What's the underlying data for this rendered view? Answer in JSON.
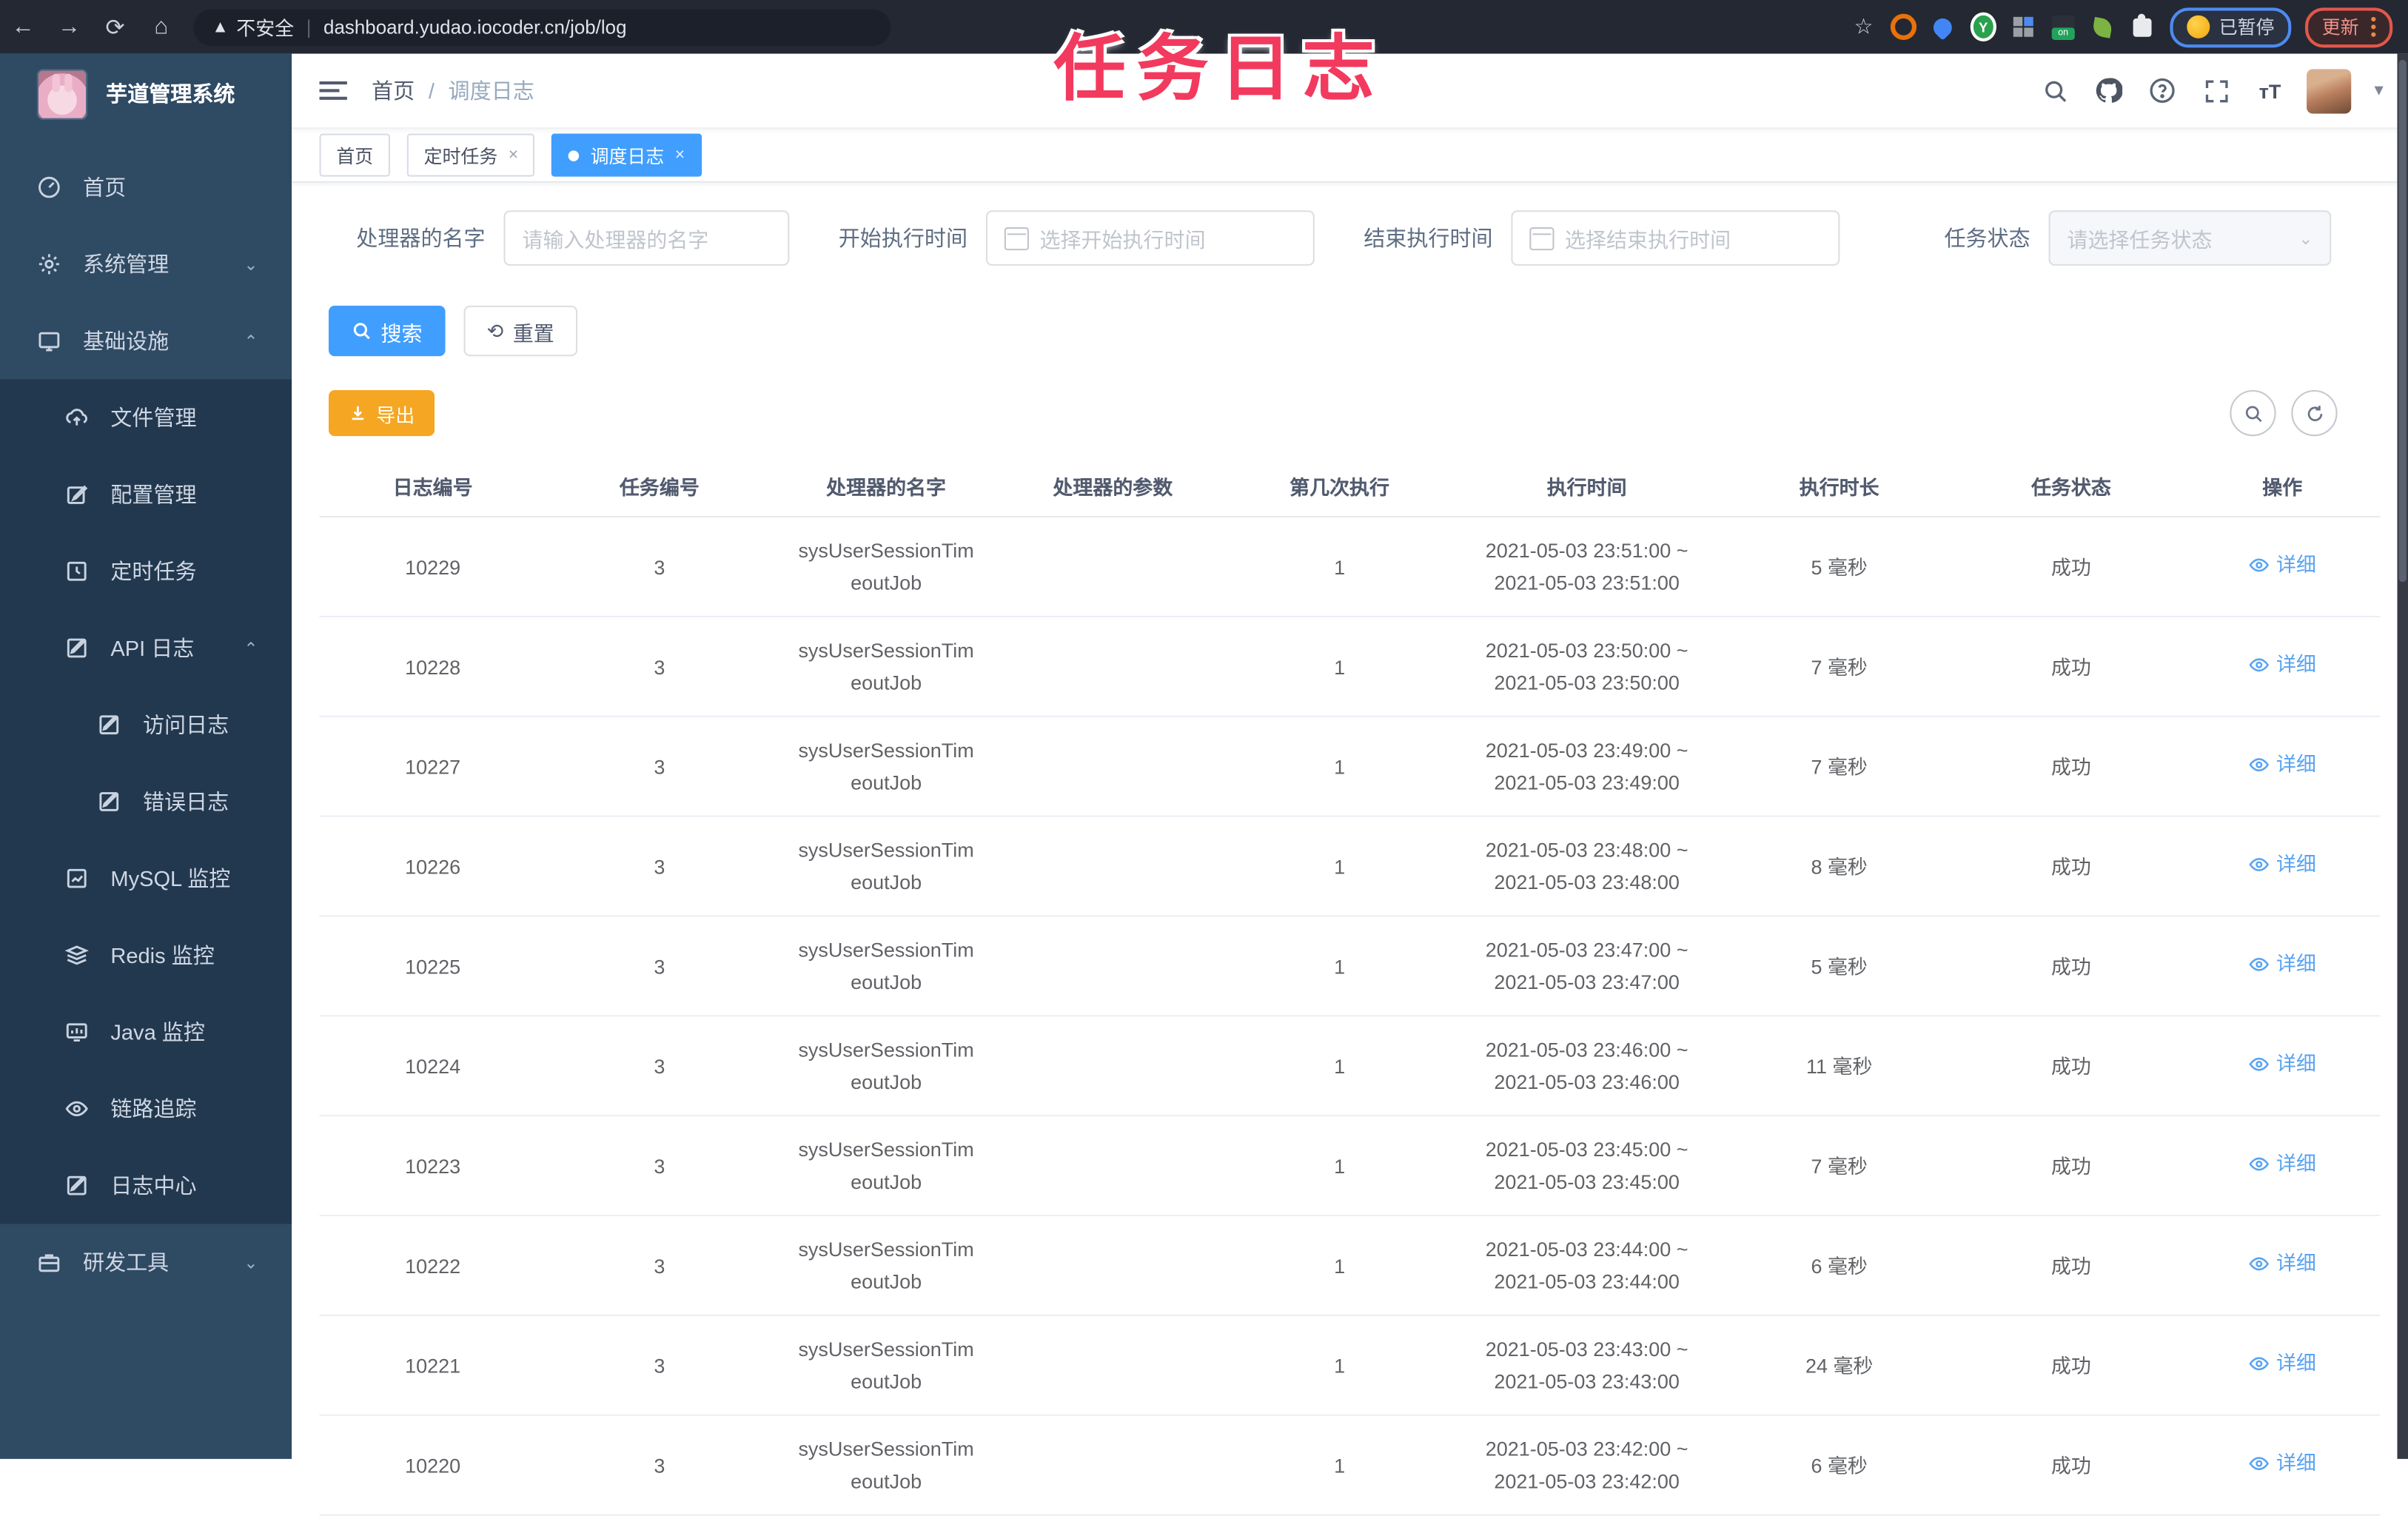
{
  "browser": {
    "security_label": "不安全",
    "url": "dashboard.yudao.iocoder.cn/job/log",
    "paused_badge": "已暂停",
    "update_button": "更新"
  },
  "overlay_title": "任务日志",
  "sidebar": {
    "app_title": "芋道管理系统",
    "items": [
      {
        "label": "首页"
      },
      {
        "label": "系统管理"
      },
      {
        "label": "基础设施"
      },
      {
        "label": "文件管理"
      },
      {
        "label": "配置管理"
      },
      {
        "label": "定时任务"
      },
      {
        "label": "API 日志"
      },
      {
        "label": "访问日志"
      },
      {
        "label": "错误日志"
      },
      {
        "label": "MySQL 监控"
      },
      {
        "label": "Redis 监控"
      },
      {
        "label": "Java 监控"
      },
      {
        "label": "链路追踪"
      },
      {
        "label": "日志中心"
      },
      {
        "label": "研发工具"
      }
    ]
  },
  "breadcrumb": {
    "home": "首页",
    "sep": "/",
    "current": "调度日志"
  },
  "tabs": [
    {
      "label": "首页"
    },
    {
      "label": "定时任务",
      "close": "×"
    },
    {
      "label": "调度日志",
      "close": "×"
    }
  ],
  "filters": {
    "handler_label": "处理器的名字",
    "handler_placeholder": "请输入处理器的名字",
    "start_label": "开始执行时间",
    "start_placeholder": "选择开始执行时间",
    "end_label": "结束执行时间",
    "end_placeholder": "选择结束执行时间",
    "status_label": "任务状态",
    "status_placeholder": "请选择任务状态"
  },
  "actions": {
    "search": "搜索",
    "reset": "重置",
    "export": "导出"
  },
  "colors": {
    "accent": "#409eff",
    "warning": "#f5a623",
    "link": "#57a3f3",
    "overlay": "#f23a5e",
    "sidebar_bg": "#2f4a63",
    "submenu_bg": "#22384e"
  },
  "table": {
    "columns": [
      "日志编号",
      "任务编号",
      "处理器的名字",
      "处理器的参数",
      "第几次执行",
      "执行时间",
      "执行时长",
      "任务状态",
      "操作"
    ],
    "rows": [
      {
        "id": "10229",
        "job": "3",
        "handler1": "sysUserSessionTim",
        "handler2": "eoutJob",
        "param": "",
        "idx": "1",
        "time1": "2021-05-03 23:51:00 ~",
        "time2": "2021-05-03 23:51:00",
        "dur": "5 毫秒",
        "status": "成功",
        "op": "详细"
      },
      {
        "id": "10228",
        "job": "3",
        "handler1": "sysUserSessionTim",
        "handler2": "eoutJob",
        "param": "",
        "idx": "1",
        "time1": "2021-05-03 23:50:00 ~",
        "time2": "2021-05-03 23:50:00",
        "dur": "7 毫秒",
        "status": "成功",
        "op": "详细"
      },
      {
        "id": "10227",
        "job": "3",
        "handler1": "sysUserSessionTim",
        "handler2": "eoutJob",
        "param": "",
        "idx": "1",
        "time1": "2021-05-03 23:49:00 ~",
        "time2": "2021-05-03 23:49:00",
        "dur": "7 毫秒",
        "status": "成功",
        "op": "详细"
      },
      {
        "id": "10226",
        "job": "3",
        "handler1": "sysUserSessionTim",
        "handler2": "eoutJob",
        "param": "",
        "idx": "1",
        "time1": "2021-05-03 23:48:00 ~",
        "time2": "2021-05-03 23:48:00",
        "dur": "8 毫秒",
        "status": "成功",
        "op": "详细"
      },
      {
        "id": "10225",
        "job": "3",
        "handler1": "sysUserSessionTim",
        "handler2": "eoutJob",
        "param": "",
        "idx": "1",
        "time1": "2021-05-03 23:47:00 ~",
        "time2": "2021-05-03 23:47:00",
        "dur": "5 毫秒",
        "status": "成功",
        "op": "详细"
      },
      {
        "id": "10224",
        "job": "3",
        "handler1": "sysUserSessionTim",
        "handler2": "eoutJob",
        "param": "",
        "idx": "1",
        "time1": "2021-05-03 23:46:00 ~",
        "time2": "2021-05-03 23:46:00",
        "dur": "11 毫秒",
        "status": "成功",
        "op": "详细"
      },
      {
        "id": "10223",
        "job": "3",
        "handler1": "sysUserSessionTim",
        "handler2": "eoutJob",
        "param": "",
        "idx": "1",
        "time1": "2021-05-03 23:45:00 ~",
        "time2": "2021-05-03 23:45:00",
        "dur": "7 毫秒",
        "status": "成功",
        "op": "详细"
      },
      {
        "id": "10222",
        "job": "3",
        "handler1": "sysUserSessionTim",
        "handler2": "eoutJob",
        "param": "",
        "idx": "1",
        "time1": "2021-05-03 23:44:00 ~",
        "time2": "2021-05-03 23:44:00",
        "dur": "6 毫秒",
        "status": "成功",
        "op": "详细"
      },
      {
        "id": "10221",
        "job": "3",
        "handler1": "sysUserSessionTim",
        "handler2": "eoutJob",
        "param": "",
        "idx": "1",
        "time1": "2021-05-03 23:43:00 ~",
        "time2": "2021-05-03 23:43:00",
        "dur": "24 毫秒",
        "status": "成功",
        "op": "详细"
      },
      {
        "id": "10220",
        "job": "3",
        "handler1": "sysUserSessionTim",
        "handler2": "eoutJob",
        "param": "",
        "idx": "1",
        "time1": "2021-05-03 23:42:00 ~",
        "time2": "2021-05-03 23:42:00",
        "dur": "6 毫秒",
        "status": "成功",
        "op": "详细"
      }
    ]
  }
}
